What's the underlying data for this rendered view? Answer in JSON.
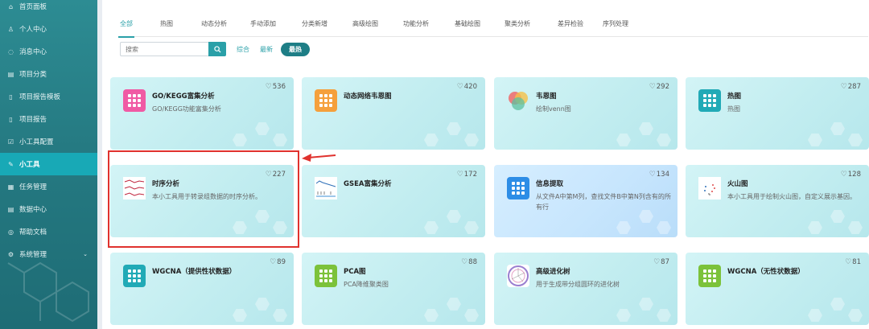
{
  "sidebar": {
    "items": [
      {
        "label": "首页面板",
        "icon": "home-icon",
        "glyph": "⌂"
      },
      {
        "label": "个人中心",
        "icon": "user-icon",
        "glyph": "♙"
      },
      {
        "label": "消息中心",
        "icon": "message-icon",
        "glyph": "◌"
      },
      {
        "label": "项目分类",
        "icon": "folder-icon",
        "glyph": "▤"
      },
      {
        "label": "项目报告模板",
        "icon": "report-template-icon",
        "glyph": "▯"
      },
      {
        "label": "项目报告",
        "icon": "report-icon",
        "glyph": "▯"
      },
      {
        "label": "小工具配置",
        "icon": "config-icon",
        "glyph": "☑"
      },
      {
        "label": "小工具",
        "icon": "wrench-icon",
        "glyph": "✎"
      },
      {
        "label": "任务管理",
        "icon": "task-icon",
        "glyph": "▦"
      },
      {
        "label": "数据中心",
        "icon": "database-icon",
        "glyph": "▤"
      },
      {
        "label": "帮助文档",
        "icon": "help-icon",
        "glyph": "◎"
      },
      {
        "label": "系统管理",
        "icon": "settings-icon",
        "glyph": "⚙"
      }
    ],
    "active_index": 7
  },
  "tabs": [
    "全部",
    "热图",
    "动态分析",
    "手动添加",
    "分类新增",
    "高级绘图",
    "功能分析",
    "基础绘图",
    "聚类分析",
    "差异检验",
    "序列处理"
  ],
  "search": {
    "placeholder": "搜索"
  },
  "sort": {
    "comprehensive": "综合",
    "newest": "最新",
    "hottest": "最热"
  },
  "cards": [
    {
      "title": "GO/KEGG富集分析",
      "desc": "GO/KEGG功能富集分析",
      "likes": "536",
      "thumb": "pink-grid",
      "color": "#f05aa4"
    },
    {
      "title": "动态网络韦恩图",
      "desc": "",
      "likes": "420",
      "thumb": "orange-grid",
      "color": "#f5a03c"
    },
    {
      "title": "韦恩图",
      "desc": "绘制venn图",
      "likes": "292",
      "thumb": "venn",
      "color": "#e94c4c"
    },
    {
      "title": "热图",
      "desc": "热图",
      "likes": "287",
      "thumb": "teal-grid",
      "color": "#21aab6"
    },
    {
      "title": "时序分析",
      "desc": "本小工具用于转录组数据的时序分析。",
      "likes": "227",
      "thumb": "timeseries",
      "color": "#c0243c"
    },
    {
      "title": "GSEA富集分析",
      "desc": "",
      "likes": "172",
      "thumb": "gsea",
      "color": "#2e6fb8"
    },
    {
      "title": "信息提取",
      "desc": "从文件A中第M列，查找文件B中第N列含有的所有行",
      "likes": "134",
      "thumb": "blue-grid",
      "color": "#2d8de6"
    },
    {
      "title": "火山图",
      "desc": "本小工具用于绘制火山图，自定义展示基因。",
      "likes": "128",
      "thumb": "volcano",
      "color": "#e04a4a"
    },
    {
      "title": "WGCNA（提供性状数据）",
      "desc": "",
      "likes": "89",
      "thumb": "teal-grid",
      "color": "#21aab6"
    },
    {
      "title": "PCA图",
      "desc": "PCA降维聚类图",
      "likes": "88",
      "thumb": "green-grid",
      "color": "#7cc23a"
    },
    {
      "title": "高级进化树",
      "desc": "用于生成带分组圆环的进化树",
      "likes": "87",
      "thumb": "tree",
      "color": "#9a7fd0"
    },
    {
      "title": "WGCNA（无性状数据）",
      "desc": "",
      "likes": "81",
      "thumb": "green-grid",
      "color": "#7cc23a"
    }
  ]
}
